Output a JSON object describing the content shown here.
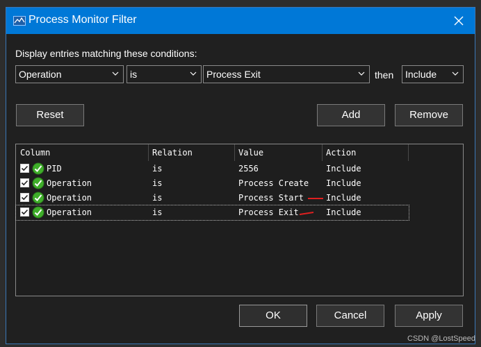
{
  "window": {
    "title": "Process Monitor Filter",
    "accent": "#0078d7"
  },
  "filter": {
    "prompt": "Display entries matching these conditions:",
    "column_value": "Operation",
    "relation_value": "is",
    "value_value": "Process Exit",
    "then_label": "then",
    "action_value": "Include"
  },
  "buttons": {
    "reset": "Reset",
    "add": "Add",
    "remove": "Remove",
    "ok": "OK",
    "cancel": "Cancel",
    "apply": "Apply"
  },
  "table": {
    "headers": [
      "Column",
      "Relation",
      "Value",
      "Action"
    ],
    "rows": [
      {
        "column": "PID",
        "relation": "is",
        "value": "2556",
        "action": "Include",
        "checked": true
      },
      {
        "column": "Operation",
        "relation": "is",
        "value": "Process Create",
        "action": "Include",
        "checked": true
      },
      {
        "column": "Operation",
        "relation": "is",
        "value": "Process Start",
        "action": "Include",
        "checked": true
      },
      {
        "column": "Operation",
        "relation": "is",
        "value": "Process Exit",
        "action": "Include",
        "checked": true
      }
    ]
  },
  "watermark": "CSDN @LostSpeed"
}
